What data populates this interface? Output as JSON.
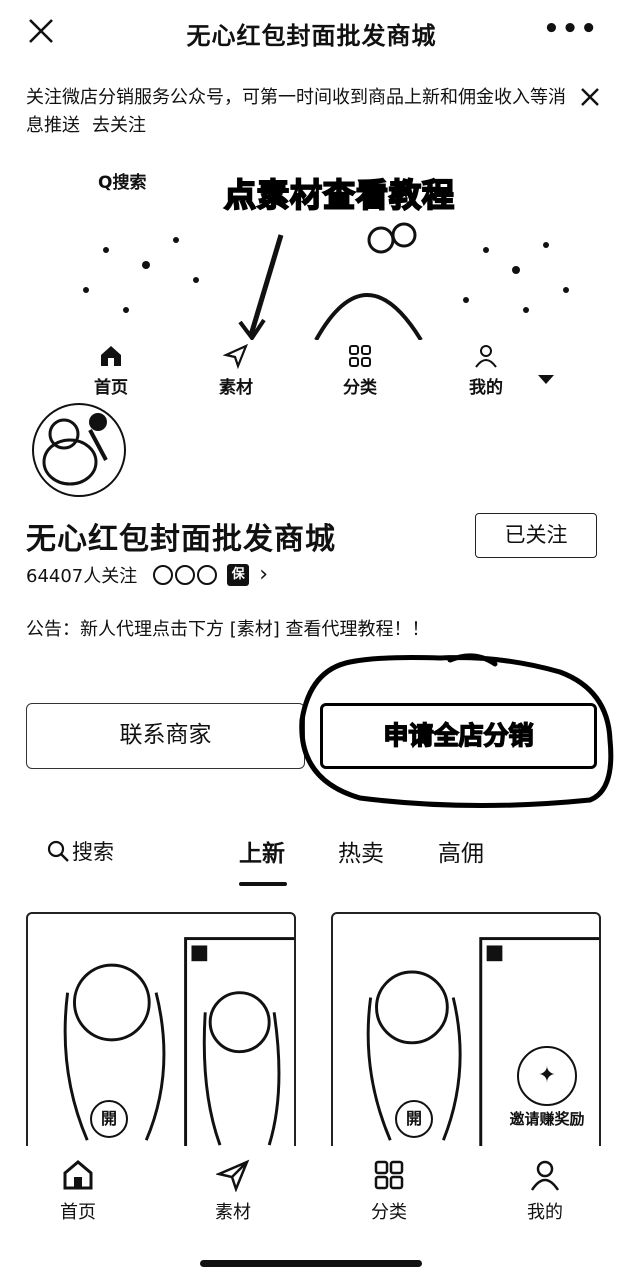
{
  "topbar": {
    "title": "无心红包封面批发商城",
    "more": "•••"
  },
  "notice": {
    "text": "关注微店分销服务公众号，可第一时间收到商品上新和佣金收入等消息推送",
    "link": "去关注"
  },
  "banner": {
    "search_hint": "Q搜索",
    "tutorial_caption": "点素材查看教程",
    "mini_nav": [
      "首页",
      "素材",
      "分类",
      "我的"
    ]
  },
  "shop": {
    "name": "无心红包封面批发商城",
    "followed_label": "已关注",
    "followers": "64407人关注",
    "guarantee_badge": "保"
  },
  "announcement": "公告：新人代理点击下方 [素材] 查看代理教程！！",
  "actions": {
    "contact": "联系商家",
    "apply": "申请全店分销"
  },
  "tabs": {
    "search": "搜索",
    "items": [
      "上新",
      "热卖",
      "高佣"
    ],
    "active": "上新"
  },
  "products": [
    {
      "badge": "開",
      "invite": ""
    },
    {
      "badge": "開",
      "invite": "邀请赚奖励"
    }
  ],
  "bottom_nav": [
    "首页",
    "素材",
    "分类",
    "我的"
  ],
  "colors": {
    "text": "#111111",
    "background": "#ffffff",
    "border": "#222222"
  }
}
